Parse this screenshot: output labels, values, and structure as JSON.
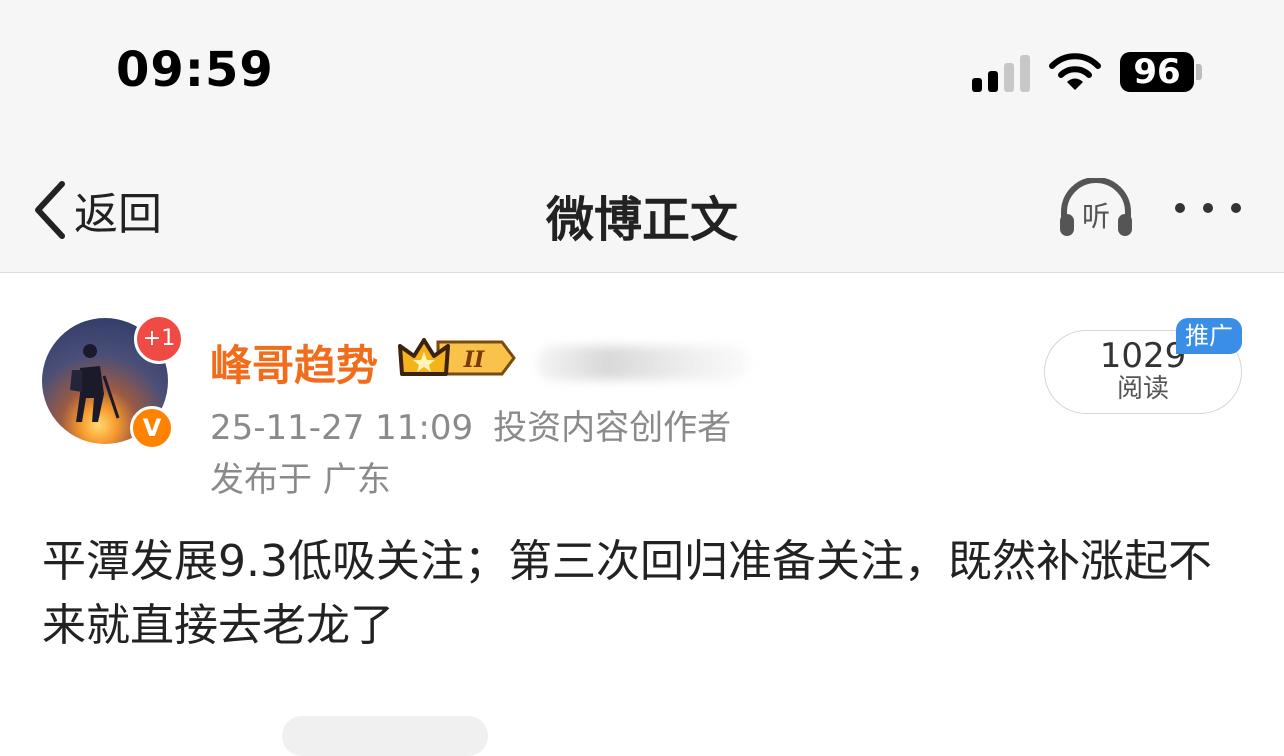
{
  "status_bar": {
    "time": "09:59",
    "battery": "96"
  },
  "nav": {
    "back_label": "返回",
    "title": "微博正文",
    "listen_label": "听"
  },
  "post": {
    "avatar_badge": "+1",
    "verified_badge": "V",
    "username": "峰哥趋势",
    "member_badge": "II",
    "timestamp": "25-11-27 11:09",
    "author_type": "投资内容创作者",
    "location": "发布于 广东",
    "reads_count": "1029",
    "reads_label": "阅读",
    "promo_label": "推广",
    "text": "平潭发展9.3低吸关注；第三次回归准备关注，既然补涨起不来就直接去老龙了"
  },
  "colors": {
    "username": "#f26d1b",
    "verified": "#ff8200",
    "notify": "#f04a45",
    "promo": "#3a8ee6",
    "crown_gold": "#f5b21a"
  }
}
